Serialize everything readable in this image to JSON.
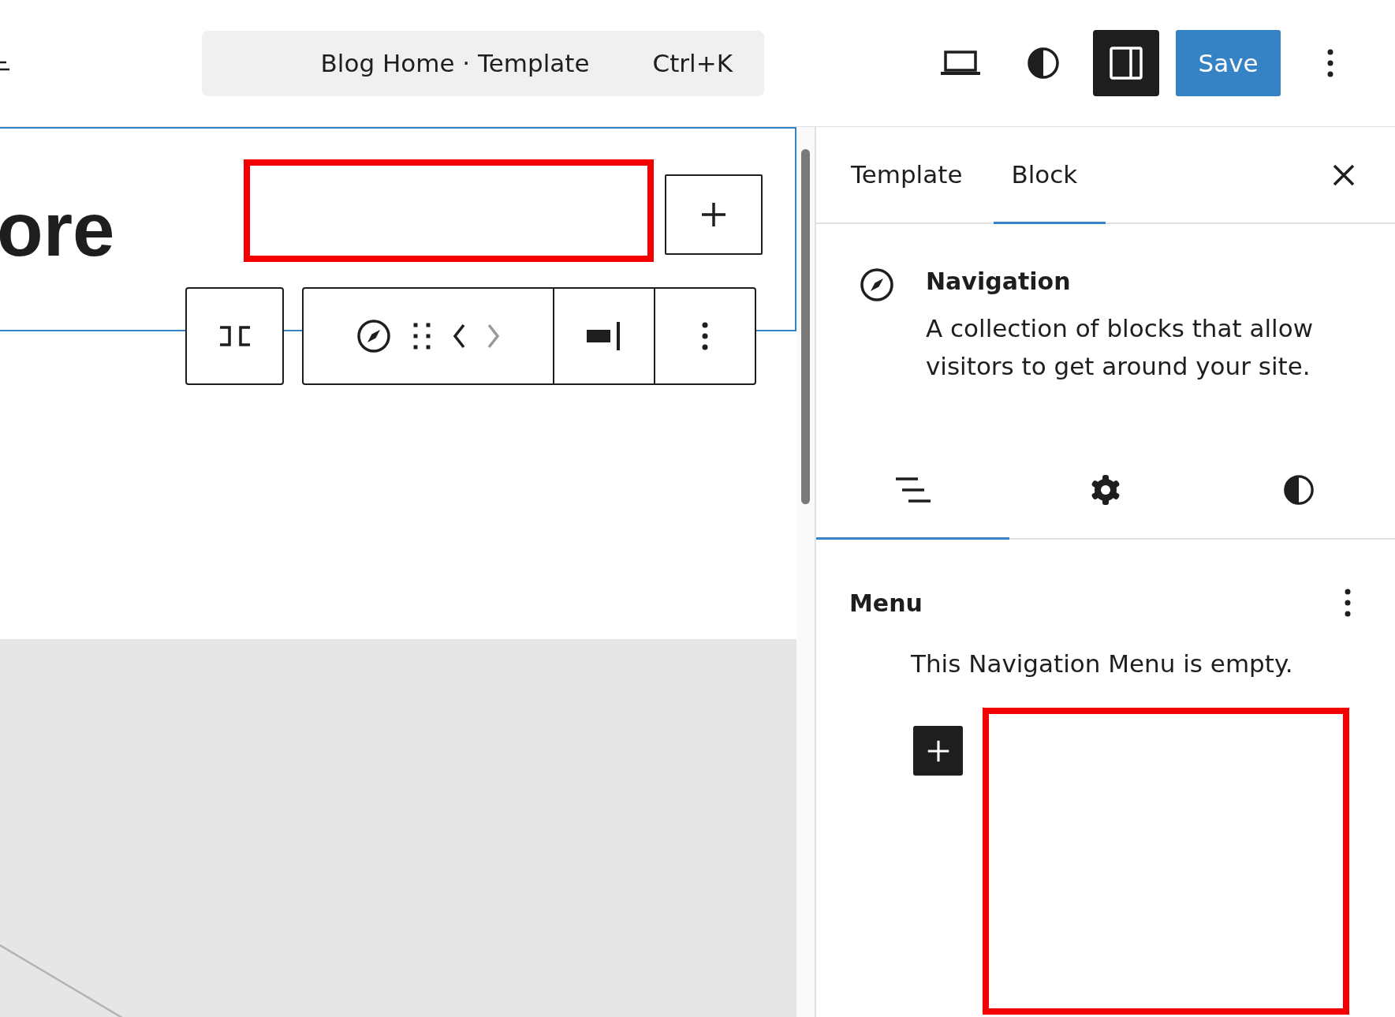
{
  "header": {
    "command_bar": {
      "title": "Blog Home · Template",
      "shortcut": "Ctrl+K"
    },
    "sidebar_toggle": {
      "on": true
    },
    "save_button": "Save"
  },
  "canvas": {
    "heading": "ore"
  },
  "sidebar": {
    "tabs": [
      {
        "label": "Template",
        "selected": false
      },
      {
        "label": "Block",
        "selected": true
      }
    ],
    "block_card": {
      "title": "Navigation",
      "description": "A collection of blocks that allow visitors to get around your site."
    },
    "sub_tabs": [
      {
        "kind": "list",
        "selected": true
      },
      {
        "kind": "settings",
        "selected": false
      },
      {
        "kind": "styles",
        "selected": false
      }
    ],
    "menu": {
      "title": "Menu",
      "empty_message": "This Navigation Menu is empty."
    }
  }
}
